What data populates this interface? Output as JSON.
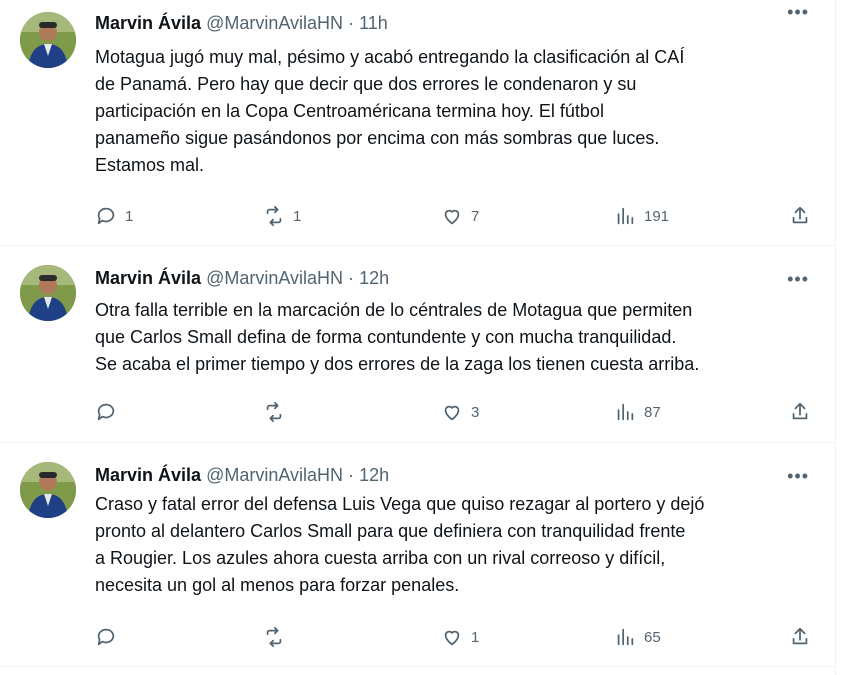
{
  "tweets": [
    {
      "name": "Marvin Ávila",
      "handle": "@MarvinAvilaHN",
      "dot": "·",
      "time": "11h",
      "text": "Motagua jugó muy mal, pésimo y acabó entregando la clasificación al CAÍ\nde Panamá. Pero hay que decir que dos errores le condenaron y su\nparticipación en la Copa Centroaméricana termina hoy. El fútbol\npanameño sigue pasándonos por encima con más sombras que luces.\nEstamos mal.",
      "replies": "1",
      "retweets": "1",
      "likes": "7",
      "views": "191"
    },
    {
      "name": "Marvin Ávila",
      "handle": "@MarvinAvilaHN",
      "dot": "·",
      "time": "12h",
      "text": "Otra falla terrible en la marcación de lo céntrales de Motagua que permiten\nque Carlos Small defina de forma contundente y con mucha tranquilidad.\nSe acaba el primer tiempo y dos errores de la zaga los tienen cuesta arriba.",
      "replies": "",
      "retweets": "",
      "likes": "3",
      "views": "87"
    },
    {
      "name": "Marvin Ávila",
      "handle": "@MarvinAvilaHN",
      "dot": "·",
      "time": "12h",
      "text": "Craso y fatal error del defensa Luis Vega que quiso rezagar al portero y dejó\npronto al delantero Carlos Small para que definiera con tranquilidad frente\na Rougier. Los azules ahora cuesta arriba con un rival correoso y difícil,\nnecesita un gol al menos para forzar penales.",
      "replies": "",
      "retweets": "",
      "likes": "1",
      "views": "65"
    }
  ],
  "icons": {
    "more": "more-horizontal-icon",
    "reply": "reply-icon",
    "retweet": "retweet-icon",
    "like": "heart-icon",
    "views": "views-chart-icon",
    "share": "share-icon"
  },
  "colors": {
    "text": "#0f1419",
    "secondary": "#536471",
    "divider": "#eff3f4"
  }
}
